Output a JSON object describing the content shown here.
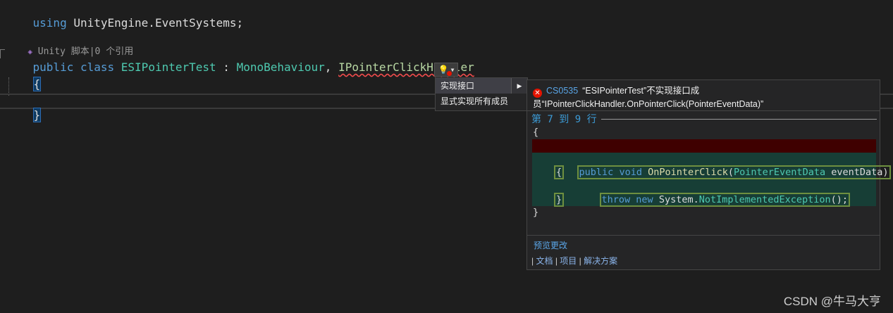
{
  "editor": {
    "line1": {
      "using_kw": "using",
      "namespace": "UnityEngine.EventSystems;"
    },
    "codelens": "Unity 脚本|0 个引用",
    "line3": {
      "public_kw": "public",
      "class_kw": "class",
      "class_name": "ESIPointerTest",
      "colon": ":",
      "base_class": "MonoBehaviour",
      "comma": ",",
      "interface": "IPointerClickHandler"
    },
    "open_brace": "{",
    "close_brace": "}"
  },
  "quick_actions": {
    "icon": "lightbulb-error-icon",
    "items": [
      {
        "label": "实现接口",
        "selected": true,
        "has_submenu": true
      },
      {
        "label": "显式实现所有成员",
        "selected": false,
        "has_submenu": false
      }
    ]
  },
  "preview": {
    "error_code": "CS0535",
    "error_message": "“ESIPointerTest”不实现接口成员“IPointerClickHandler.OnPointerClick(PointerEventData)”",
    "lines_label": "第 7 到 9 行",
    "code": {
      "brace_open": "{",
      "public_kw": "public",
      "void_kw": "void",
      "method": "OnPointerClick",
      "param_type": "PointerEventData",
      "param_name": "eventData)",
      "paren_open": "(",
      "inner_open": "{",
      "throw_kw": "throw",
      "new_kw": "new",
      "system": "System.",
      "exception": "NotImplementedException",
      "call_end": "();",
      "inner_close": "}",
      "brace_close": "}"
    },
    "preview_changes": "预览更改",
    "footer": {
      "doc": "文档",
      "project": "项目",
      "solution": "解决方案",
      "sep": "|"
    }
  },
  "watermark": "CSDN @牛马大亨",
  "colors": {
    "keyword": "#569cd6",
    "type": "#4ec9b0",
    "interface": "#b8d7a3",
    "method": "#dcdcaa",
    "error": "#e51400"
  }
}
